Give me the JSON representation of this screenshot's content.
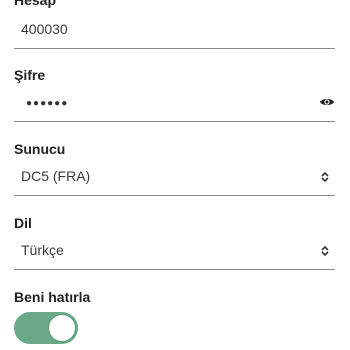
{
  "account": {
    "label": "Hesap",
    "value": "400030"
  },
  "password": {
    "label": "Şifre",
    "masked_value": "●●●●●●",
    "toggle_icon": "eye-icon"
  },
  "server": {
    "label": "Sunucu",
    "value": "DC5 (FRA)",
    "icon": "chevron-up-down-icon"
  },
  "language": {
    "label": "Dil",
    "value": "Türkçe",
    "icon": "chevron-up-down-icon"
  },
  "remember": {
    "label": "Beni hatırla",
    "enabled": true
  },
  "colors": {
    "toggle_on": "#6aa88a",
    "text": "#222222",
    "underline": "#8a8a8a"
  }
}
